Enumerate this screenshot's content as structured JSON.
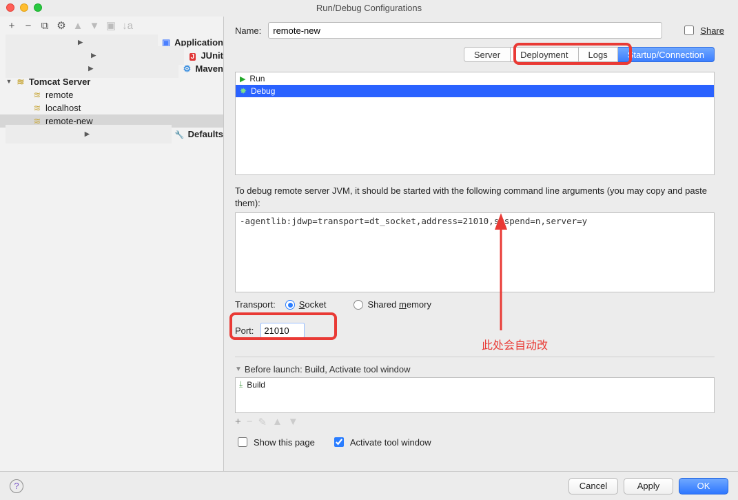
{
  "window": {
    "title": "Run/Debug Configurations"
  },
  "name": {
    "label": "Name:",
    "value": "remote-new",
    "share": "Share"
  },
  "tree": {
    "application": "Application",
    "junit": "JUnit",
    "maven": "Maven",
    "tomcat": "Tomcat Server",
    "tomcat_children": [
      "remote",
      "localhost",
      "remote-new"
    ],
    "defaults": "Defaults"
  },
  "tabs": [
    "Server",
    "Deployment",
    "Logs",
    "Startup/Connection"
  ],
  "runlist": {
    "run": "Run",
    "debug": "Debug"
  },
  "argslabel": "To debug remote server JVM, it should be started with the following command line arguments (you may copy and paste them):",
  "argsvalue": "-agentlib:jdwp=transport=dt_socket,address=21010,suspend=n,server=y",
  "transport": {
    "label": "Transport:",
    "socket": "Socket",
    "shared": "Shared memory"
  },
  "port": {
    "label": "Port:",
    "value": "21010"
  },
  "before": {
    "label": "Before launch: Build, Activate tool window",
    "build": "Build"
  },
  "checks": {
    "show": "Show this page",
    "activate": "Activate tool window"
  },
  "buttons": {
    "cancel": "Cancel",
    "apply": "Apply",
    "ok": "OK"
  },
  "anno": {
    "text": "此处会自动改"
  }
}
